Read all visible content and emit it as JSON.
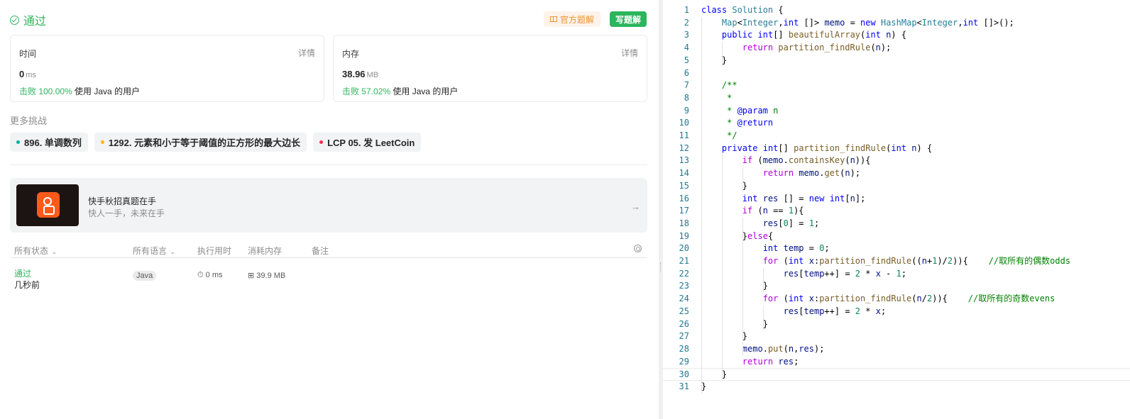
{
  "result": {
    "status": "通过",
    "official_button": "官方题解",
    "write_button": "写题解"
  },
  "time_card": {
    "title": "时间",
    "detail": "详情",
    "value": "0",
    "unit": "ms",
    "beat_label": "击败 100.00%",
    "beat_suffix": " 使用 Java 的用户"
  },
  "memory_card": {
    "title": "内存",
    "detail": "详情",
    "value": "38.96",
    "unit": "MB",
    "beat_label": "击败 57.02%",
    "beat_suffix": " 使用 Java 的用户"
  },
  "more_challenges": {
    "title": "更多挑战",
    "items": [
      {
        "label": "896. 单调数列",
        "color": "#00af9b"
      },
      {
        "label": "1292. 元素和小于等于阈值的正方形的最大边长",
        "color": "#ffb800"
      },
      {
        "label": "LCP 05. 发 LeetCoin",
        "color": "#ff2d55"
      }
    ]
  },
  "banner": {
    "title": "快手秋招真题在手",
    "subtitle": "快人一手，未来在手"
  },
  "submissions": {
    "headers": {
      "status": "所有状态",
      "language": "所有语言",
      "runtime": "执行用时",
      "memory": "消耗内存",
      "note": "备注"
    },
    "rows": [
      {
        "status": "通过",
        "time": "几秒前",
        "language": "Java",
        "runtime": "0 ms",
        "memory": "39.9 MB"
      }
    ]
  },
  "editor": {
    "lines": [
      {
        "n": "1",
        "code": "class Solution {"
      },
      {
        "n": "2",
        "code": "    Map<Integer,int []> memo = new HashMap<Integer,int []>();"
      },
      {
        "n": "3",
        "code": "    public int[] beautifulArray(int n) {"
      },
      {
        "n": "4",
        "code": "        return partition_findRule(n);"
      },
      {
        "n": "5",
        "code": "    }"
      },
      {
        "n": "6",
        "code": ""
      },
      {
        "n": "7",
        "code": "    /**"
      },
      {
        "n": "8",
        "code": "     *"
      },
      {
        "n": "9",
        "code": "     * @param n"
      },
      {
        "n": "10",
        "code": "     * @return"
      },
      {
        "n": "11",
        "code": "     */"
      },
      {
        "n": "12",
        "code": "    private int[] partition_findRule(int n) {"
      },
      {
        "n": "13",
        "code": "        if (memo.containsKey(n)){"
      },
      {
        "n": "14",
        "code": "            return memo.get(n);"
      },
      {
        "n": "15",
        "code": "        }"
      },
      {
        "n": "16",
        "code": "        int res [] = new int[n];"
      },
      {
        "n": "17",
        "code": "        if (n == 1){"
      },
      {
        "n": "18",
        "code": "            res[0] = 1;"
      },
      {
        "n": "19",
        "code": "        }else{"
      },
      {
        "n": "20",
        "code": "            int temp = 0;"
      },
      {
        "n": "21",
        "code": "            for (int x:partition_findRule((n+1)/2)){    //取所有的偶数odds"
      },
      {
        "n": "22",
        "code": "                res[temp++] = 2 * x - 1;"
      },
      {
        "n": "23",
        "code": "            }"
      },
      {
        "n": "24",
        "code": "            for (int x:partition_findRule(n/2)){    //取所有的奇数evens"
      },
      {
        "n": "25",
        "code": "                res[temp++] = 2 * x;"
      },
      {
        "n": "26",
        "code": "            }"
      },
      {
        "n": "27",
        "code": "        }"
      },
      {
        "n": "28",
        "code": "        memo.put(n,res);"
      },
      {
        "n": "29",
        "code": "        return res;"
      },
      {
        "n": "30",
        "code": "    }"
      },
      {
        "n": "31",
        "code": "}"
      }
    ]
  }
}
